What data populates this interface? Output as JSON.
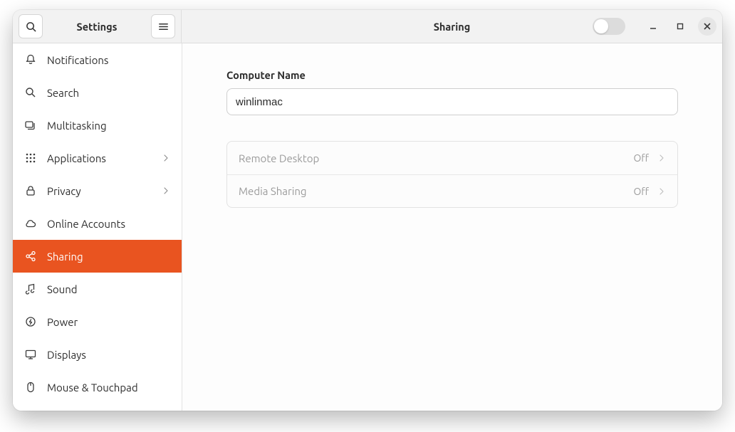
{
  "titlebar": {
    "left_title": "Settings",
    "right_title": "Sharing",
    "master_switch_on": false
  },
  "sidebar": {
    "items": [
      {
        "id": "notifications",
        "label": "Notifications",
        "icon": "bell",
        "expandable": false
      },
      {
        "id": "search",
        "label": "Search",
        "icon": "search",
        "expandable": false
      },
      {
        "id": "multitasking",
        "label": "Multitasking",
        "icon": "multitask",
        "expandable": false
      },
      {
        "id": "applications",
        "label": "Applications",
        "icon": "grid",
        "expandable": true
      },
      {
        "id": "privacy",
        "label": "Privacy",
        "icon": "lock",
        "expandable": true
      },
      {
        "id": "online-accounts",
        "label": "Online Accounts",
        "icon": "cloud",
        "expandable": false
      },
      {
        "id": "sharing",
        "label": "Sharing",
        "icon": "share",
        "expandable": false,
        "active": true
      },
      {
        "id": "sound",
        "label": "Sound",
        "icon": "music",
        "expandable": false
      },
      {
        "id": "power",
        "label": "Power",
        "icon": "power",
        "expandable": false
      },
      {
        "id": "displays",
        "label": "Displays",
        "icon": "display",
        "expandable": false
      },
      {
        "id": "mouse",
        "label": "Mouse & Touchpad",
        "icon": "mouse",
        "expandable": false
      }
    ]
  },
  "main": {
    "computer_name_label": "Computer Name",
    "computer_name_value": "winlinmac",
    "rows": [
      {
        "id": "remote-desktop",
        "label": "Remote Desktop",
        "status": "Off"
      },
      {
        "id": "media-sharing",
        "label": "Media Sharing",
        "status": "Off"
      }
    ]
  },
  "colors": {
    "accent": "#e95420"
  }
}
